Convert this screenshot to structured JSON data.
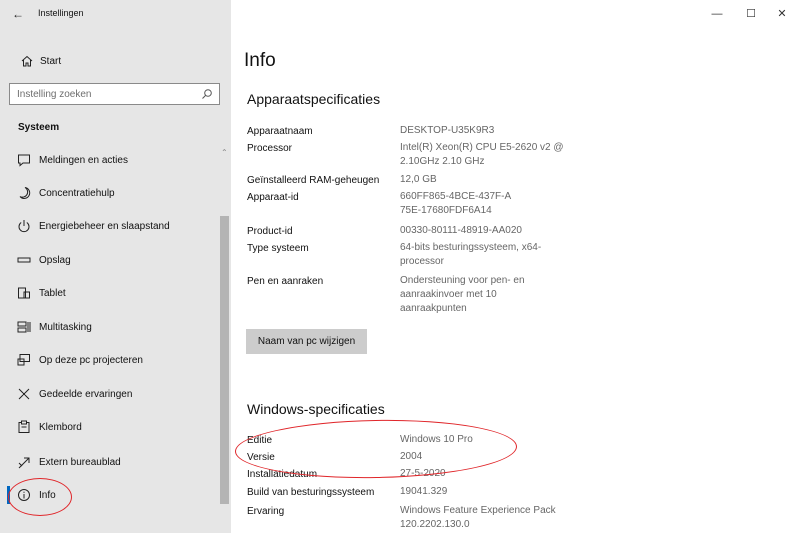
{
  "window": {
    "title": "Instellingen",
    "back_glyph": "←",
    "minimize_glyph": "—",
    "maximize_glyph": "☐",
    "close_glyph": "✕"
  },
  "sidebar": {
    "home_label": "Start",
    "search_placeholder": "Instelling zoeken",
    "section_label": "Systeem",
    "items": [
      {
        "label": "Meldingen en acties",
        "icon": "notifications-icon"
      },
      {
        "label": "Concentratiehulp",
        "icon": "moon-icon"
      },
      {
        "label": "Energiebeheer en slaapstand",
        "icon": "power-icon"
      },
      {
        "label": "Opslag",
        "icon": "storage-icon"
      },
      {
        "label": "Tablet",
        "icon": "tablet-icon"
      },
      {
        "label": "Multitasking",
        "icon": "multitasking-icon"
      },
      {
        "label": "Op deze pc projecteren",
        "icon": "projector-icon"
      },
      {
        "label": "Gedeelde ervaringen",
        "icon": "shared-experiences-icon"
      },
      {
        "label": "Klembord",
        "icon": "clipboard-icon"
      },
      {
        "label": "Extern bureaublad",
        "icon": "remote-desktop-icon"
      },
      {
        "label": "Info",
        "icon": "info-icon",
        "active": true
      }
    ]
  },
  "main": {
    "title": "Info",
    "device_specs": {
      "heading": "Apparaatspecificaties",
      "rows": [
        {
          "label": "Apparaatnaam",
          "value": "DESKTOP-U35K9R3"
        },
        {
          "label": "Processor",
          "value": "Intel(R) Xeon(R) CPU E5-2620 v2 @ 2.10GHz   2.10 GHz"
        },
        {
          "label": "Geïnstalleerd RAM-geheugen",
          "value": "12,0 GB"
        },
        {
          "label": "Apparaat-id",
          "value": "660FF865-4BCE-437F-A75E-17680FDF6A14"
        },
        {
          "label": "Product-id",
          "value": "00330-80111-48919-AA020"
        },
        {
          "label": "Type systeem",
          "value": "64-bits besturingssysteem, x64-processor"
        },
        {
          "label": "Pen en aanraken",
          "value": "Ondersteuning voor pen- en aanraakinvoer met 10 aanraakpunten"
        }
      ],
      "rename_button": "Naam van pc wijzigen"
    },
    "windows_specs": {
      "heading": "Windows-specificaties",
      "rows": [
        {
          "label": "Editie",
          "value": "Windows 10 Pro"
        },
        {
          "label": "Versie",
          "value": "2004"
        },
        {
          "label": "Installatiedatum",
          "value": "27-5-2020"
        },
        {
          "label": "Build van besturingssysteem",
          "value": "19041.329"
        },
        {
          "label": "Ervaring",
          "value": "Windows Feature Experience Pack 120.2202.130.0"
        }
      ]
    }
  },
  "colors": {
    "sidebar_bg": "#e6e6e6",
    "accent": "#0067c0",
    "annotation": "#e0262a",
    "value_text": "#666666"
  }
}
